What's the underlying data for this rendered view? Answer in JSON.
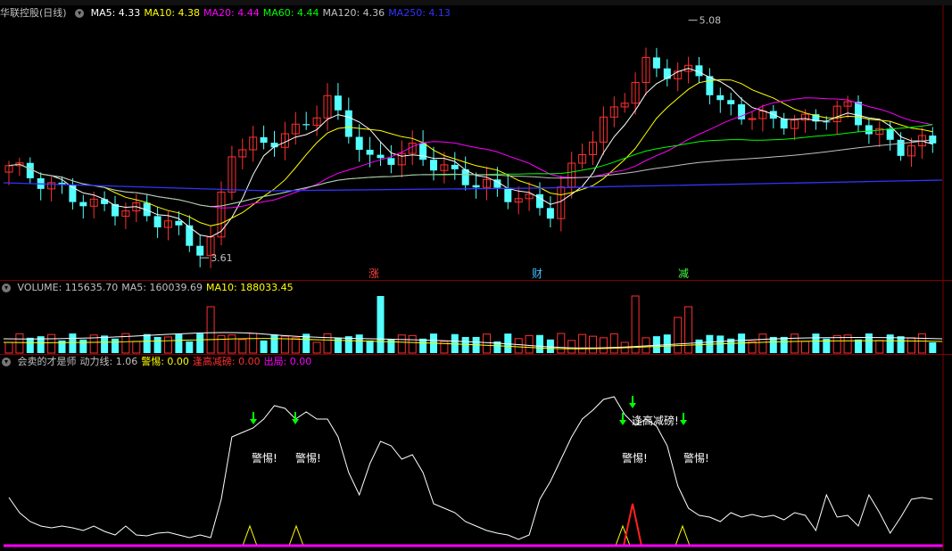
{
  "toolbar": {},
  "main_pane": {
    "stock_title": "华联控股(日线)",
    "ma_labels": [
      {
        "text": "MA5: 4.33",
        "color": "#ffffff"
      },
      {
        "text": "MA10: 4.38",
        "color": "#ffff00"
      },
      {
        "text": "MA20: 4.44",
        "color": "#ff00ff"
      },
      {
        "text": "MA60: 4.44",
        "color": "#00ff00"
      },
      {
        "text": "MA120: 4.36",
        "color": "#c0c0c0"
      },
      {
        "text": "MA250: 4.13",
        "color": "#3333ff"
      }
    ],
    "high_label": "5.08",
    "low_label": "3.61",
    "event_markers": [
      {
        "text": "涨",
        "color": "#ff4040"
      },
      {
        "text": "财",
        "color": "#40c0ff"
      },
      {
        "text": "减",
        "color": "#40ff40"
      }
    ]
  },
  "volume_pane": {
    "labels": [
      {
        "text": "VOLUME: 115635.70",
        "color": "#c0c0c0"
      },
      {
        "text": "MA5: 160039.69",
        "color": "#c0c0c0"
      },
      {
        "text": "MA10: 188033.45",
        "color": "#ffff00"
      }
    ]
  },
  "indicator_pane": {
    "labels": [
      {
        "text": "会卖的才是师",
        "color": "#c0c0c0"
      },
      {
        "text": "动力线: 1.06",
        "color": "#c0c0c0"
      },
      {
        "text": "警惕: 0.00",
        "color": "#ffff00"
      },
      {
        "text": "逢高减磅: 0.00",
        "color": "#ff3030"
      },
      {
        "text": "出局: 0.00",
        "color": "#ff00ff"
      }
    ],
    "signals": [
      "警惕!",
      "警惕!",
      "逢高减磅!",
      "警惕!",
      "警惕!"
    ]
  },
  "colors": {
    "up": "#ff3030",
    "down": "#54ffff",
    "bg": "#000000",
    "grid": "#800000"
  }
}
